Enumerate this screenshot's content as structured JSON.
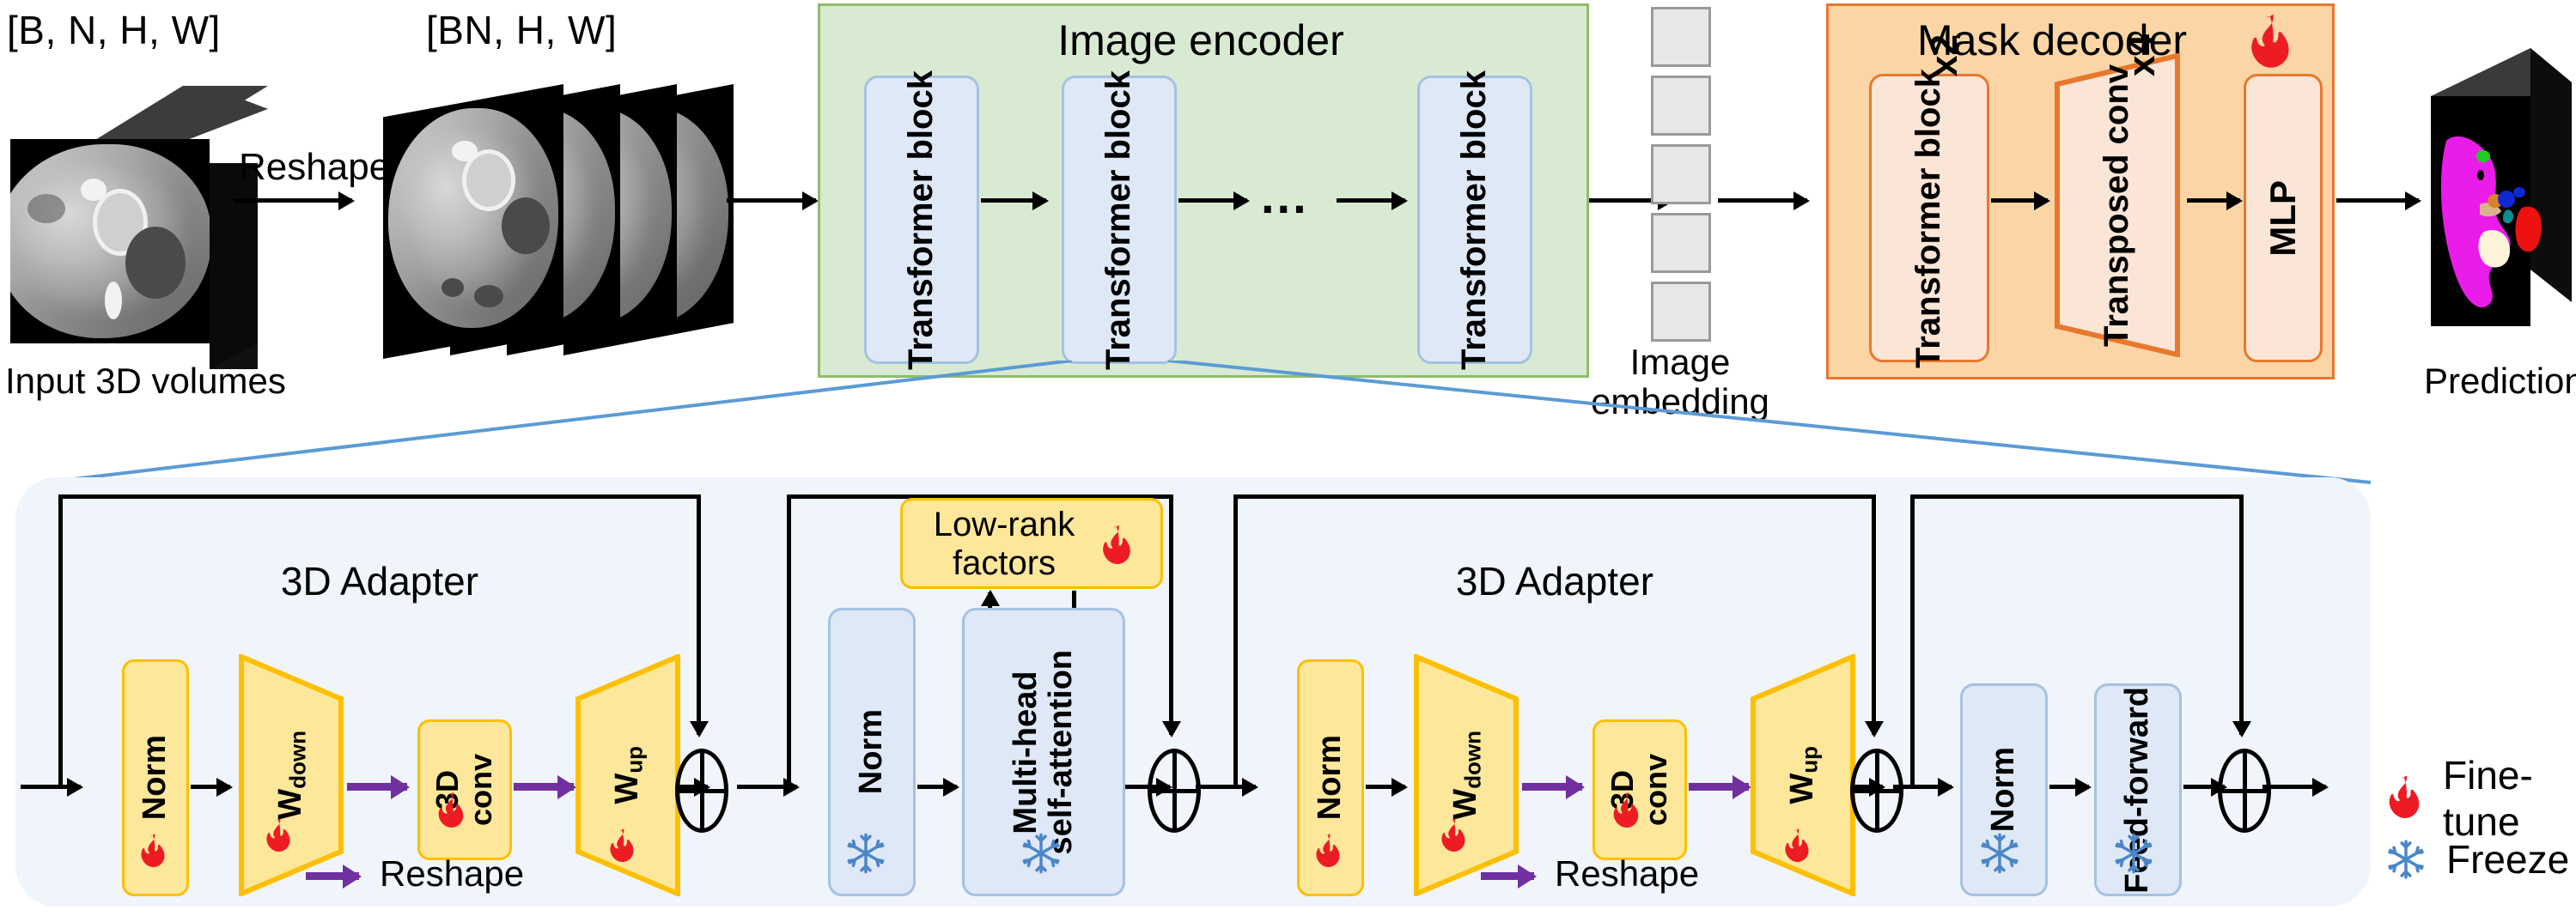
{
  "top_row": {
    "input_shape_label": "[B, N, H, W]",
    "input_caption": "Input 3D volumes",
    "reshape_label": "Reshape",
    "slices_shape_label": "[BN, H, W]",
    "encoder": {
      "title": "Image encoder",
      "blocks": [
        {
          "label": "Transformer\nblock"
        },
        {
          "label": "Transformer\nblock"
        },
        {
          "label": "Transformer\nblock"
        }
      ],
      "ellipsis": "...",
      "block1_label": "Transformer block",
      "block2_label": "Transformer block",
      "block3_label": "Transformer block"
    },
    "embedding_caption": "Image\nembedding",
    "embedding_caption_line1": "Image",
    "embedding_caption_line2": "embedding",
    "decoder": {
      "title": "Mask decoder",
      "fire_icon": "fire-icon",
      "blocks": [
        {
          "label": "Transformer block",
          "repeat": "x2"
        },
        {
          "label": "Transposed conv",
          "repeat": "x4"
        },
        {
          "label": "MLP",
          "repeat": ""
        }
      ],
      "block1_label": "Transformer block",
      "block1_repeat": "x2",
      "block2_label": "Transposed conv",
      "block2_repeat": "x4",
      "block3_label": "MLP"
    },
    "prediction_caption": "Prediction"
  },
  "bottom_panel": {
    "adapter1_title": "3D Adapter",
    "adapter2_title": "3D Adapter",
    "low_rank_label": "Low-rank\nfactors",
    "low_rank_line1": "Low-rank",
    "low_rank_line2": "factors",
    "reshape_legend_1": "Reshape",
    "reshape_legend_2": "Reshape",
    "adapter1": {
      "norm": "Norm",
      "w_down": "W",
      "w_down_sub": "down",
      "conv_line1": "3D",
      "conv_line2": "conv",
      "w_up": "W",
      "w_up_sub": "up"
    },
    "attention": {
      "norm": "Norm",
      "msa_line1": "Multi-head",
      "msa_line2": "self-attention"
    },
    "adapter2": {
      "norm": "Norm",
      "w_down": "W",
      "w_down_sub": "down",
      "conv_line1": "3D",
      "conv_line2": "conv",
      "w_up": "W",
      "w_up_sub": "up"
    },
    "ffn": {
      "norm": "Norm",
      "feed_forward": "Feed-forward"
    },
    "legend": {
      "fine_tune": "Fine-tune",
      "freeze": "Freeze",
      "fine_tune_icon": "fire-icon",
      "freeze_icon": "snowflake-icon"
    }
  },
  "colors": {
    "encoder_bg": "#d9ead3",
    "encoder_border": "#8fbc6b",
    "decoder_bg": "#fbd5a5",
    "decoder_border": "#e8782d",
    "block_blue_bg": "#dee8f6",
    "block_blue_border": "#a5c2e0",
    "block_orange_bg": "#fbe5d6",
    "block_yellow_bg": "#fde79a",
    "block_yellow_border": "#fcc000",
    "panel_bg": "#f0f4fb",
    "reshape_arrow": "#7030a0",
    "connector": "#5b9bd5",
    "fire": "#ed1c24",
    "snow": "#4a86c8"
  }
}
